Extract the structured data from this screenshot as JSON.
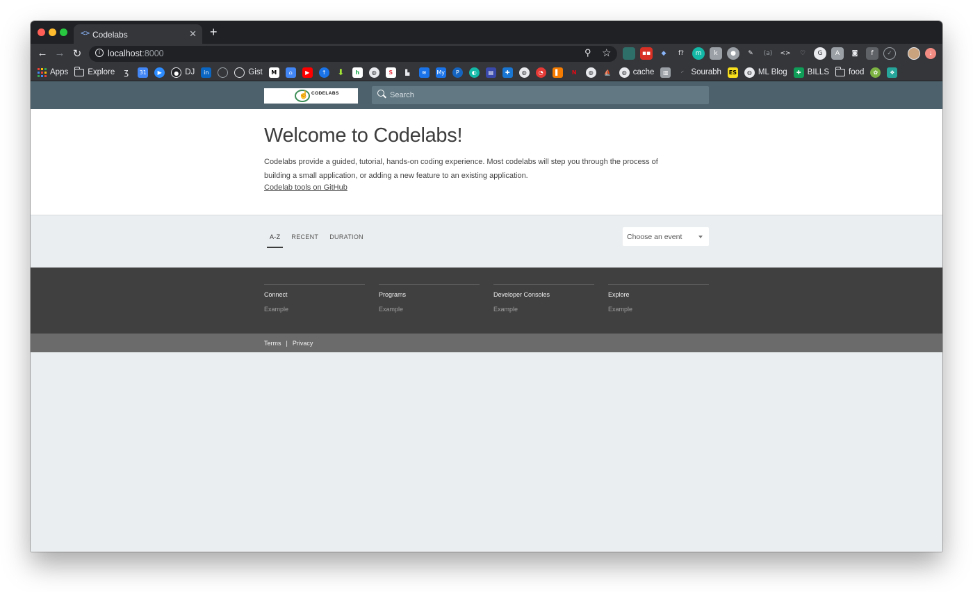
{
  "browser": {
    "tab": {
      "title": "Codelabs",
      "favicon": "code-brackets-icon"
    },
    "new_tab": "+",
    "address": {
      "host": "localhost",
      "port": ":8000"
    },
    "bookmarks": [
      {
        "label": "Apps",
        "icon": "apps-grid-icon"
      },
      {
        "label": "Explore",
        "icon": "folder-icon"
      },
      {
        "label": "DJ",
        "icon": "dj-icon"
      },
      {
        "label": "Gist",
        "icon": "github-icon"
      },
      {
        "label": "cache",
        "icon": "globe-icon"
      },
      {
        "label": "Sourabh",
        "icon": "bookmark-icon"
      },
      {
        "label": "ML Blog",
        "icon": "globe-icon"
      },
      {
        "label": "BILLS",
        "icon": "sheets-icon"
      },
      {
        "label": "food",
        "icon": "folder-icon"
      }
    ]
  },
  "header": {
    "logo_text": "CODELABS",
    "search_placeholder": "Search"
  },
  "welcome": {
    "title": "Welcome to Codelabs!",
    "description": "Codelabs provide a guided, tutorial, hands-on coding experience. Most codelabs will step you through the process of building a small application, or adding a new feature to an existing application.",
    "github_link": "Codelab tools on GitHub"
  },
  "filters": {
    "tabs": [
      "A-Z",
      "RECENT",
      "DURATION"
    ],
    "active_tab": "A-Z",
    "event_select": "Choose an event"
  },
  "footer": {
    "columns": [
      {
        "title": "Connect",
        "link": "Example"
      },
      {
        "title": "Programs",
        "link": "Example"
      },
      {
        "title": "Developer Consoles",
        "link": "Example"
      },
      {
        "title": "Explore",
        "link": "Example"
      }
    ],
    "terms": "Terms",
    "separator": "|",
    "privacy": "Privacy"
  },
  "colors": {
    "header_bar": "#4c616c",
    "footer": "#404040",
    "subfooter": "#6b6b6b",
    "page_bg": "#ebeef0"
  }
}
